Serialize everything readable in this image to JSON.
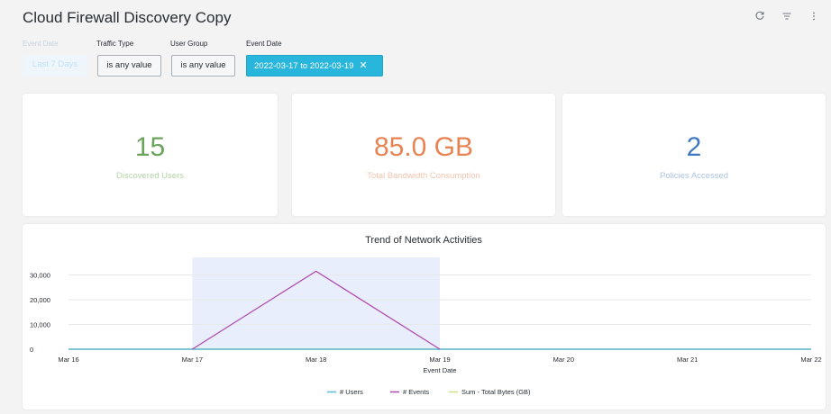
{
  "header": {
    "title": "Cloud Firewall Discovery Copy",
    "icons": [
      "refresh-icon",
      "filter-icon",
      "more-vertical-icon"
    ]
  },
  "filters": [
    {
      "label": "Event Date",
      "value": "Last 7 Days",
      "state": "faded"
    },
    {
      "label": "Traffic Type",
      "value": "is any value",
      "state": "normal"
    },
    {
      "label": "User Group",
      "value": "is any value",
      "state": "normal"
    },
    {
      "label": "Event Date",
      "value": "2022-03-17 to 2022-03-19",
      "state": "active"
    }
  ],
  "kpis": [
    {
      "value": "15",
      "label": "Discovered Users",
      "color": "#6aa45a",
      "label_color": "#b4d4a8"
    },
    {
      "value": "85.0 GB",
      "label": "Total Bandwidth Consumption",
      "color": "#e88354",
      "label_color": "#f3c4ac"
    },
    {
      "value": "2",
      "label": "Policies Accessed",
      "color": "#3f7ac0",
      "label_color": "#a9c4e4"
    }
  ],
  "chart_data": {
    "type": "line",
    "title": "Trend of Network Activities",
    "xlabel": "Event Date",
    "ylabel": "",
    "categories": [
      "Mar 16",
      "Mar 17",
      "Mar 18",
      "Mar 19",
      "Mar 20",
      "Mar 21",
      "Mar 22"
    ],
    "yticks": [
      "0",
      "10,000",
      "20,000",
      "30,000"
    ],
    "ylim": [
      0,
      36000
    ],
    "highlight_range": [
      "Mar 17",
      "Mar 19"
    ],
    "series": [
      {
        "name": "# Users",
        "color": "#5bb8d6",
        "values": [
          0,
          0,
          0,
          0,
          0,
          0,
          0
        ]
      },
      {
        "name": "# Events",
        "color": "#b046b0",
        "values": [
          null,
          0,
          31500,
          0,
          null,
          null,
          null
        ]
      },
      {
        "name": "Sum - Total Bytes (GB)",
        "color": "#cfe08a",
        "values": [
          0,
          0,
          0,
          0,
          0,
          0,
          0
        ]
      }
    ],
    "legend_position": "bottom",
    "grid": true
  }
}
